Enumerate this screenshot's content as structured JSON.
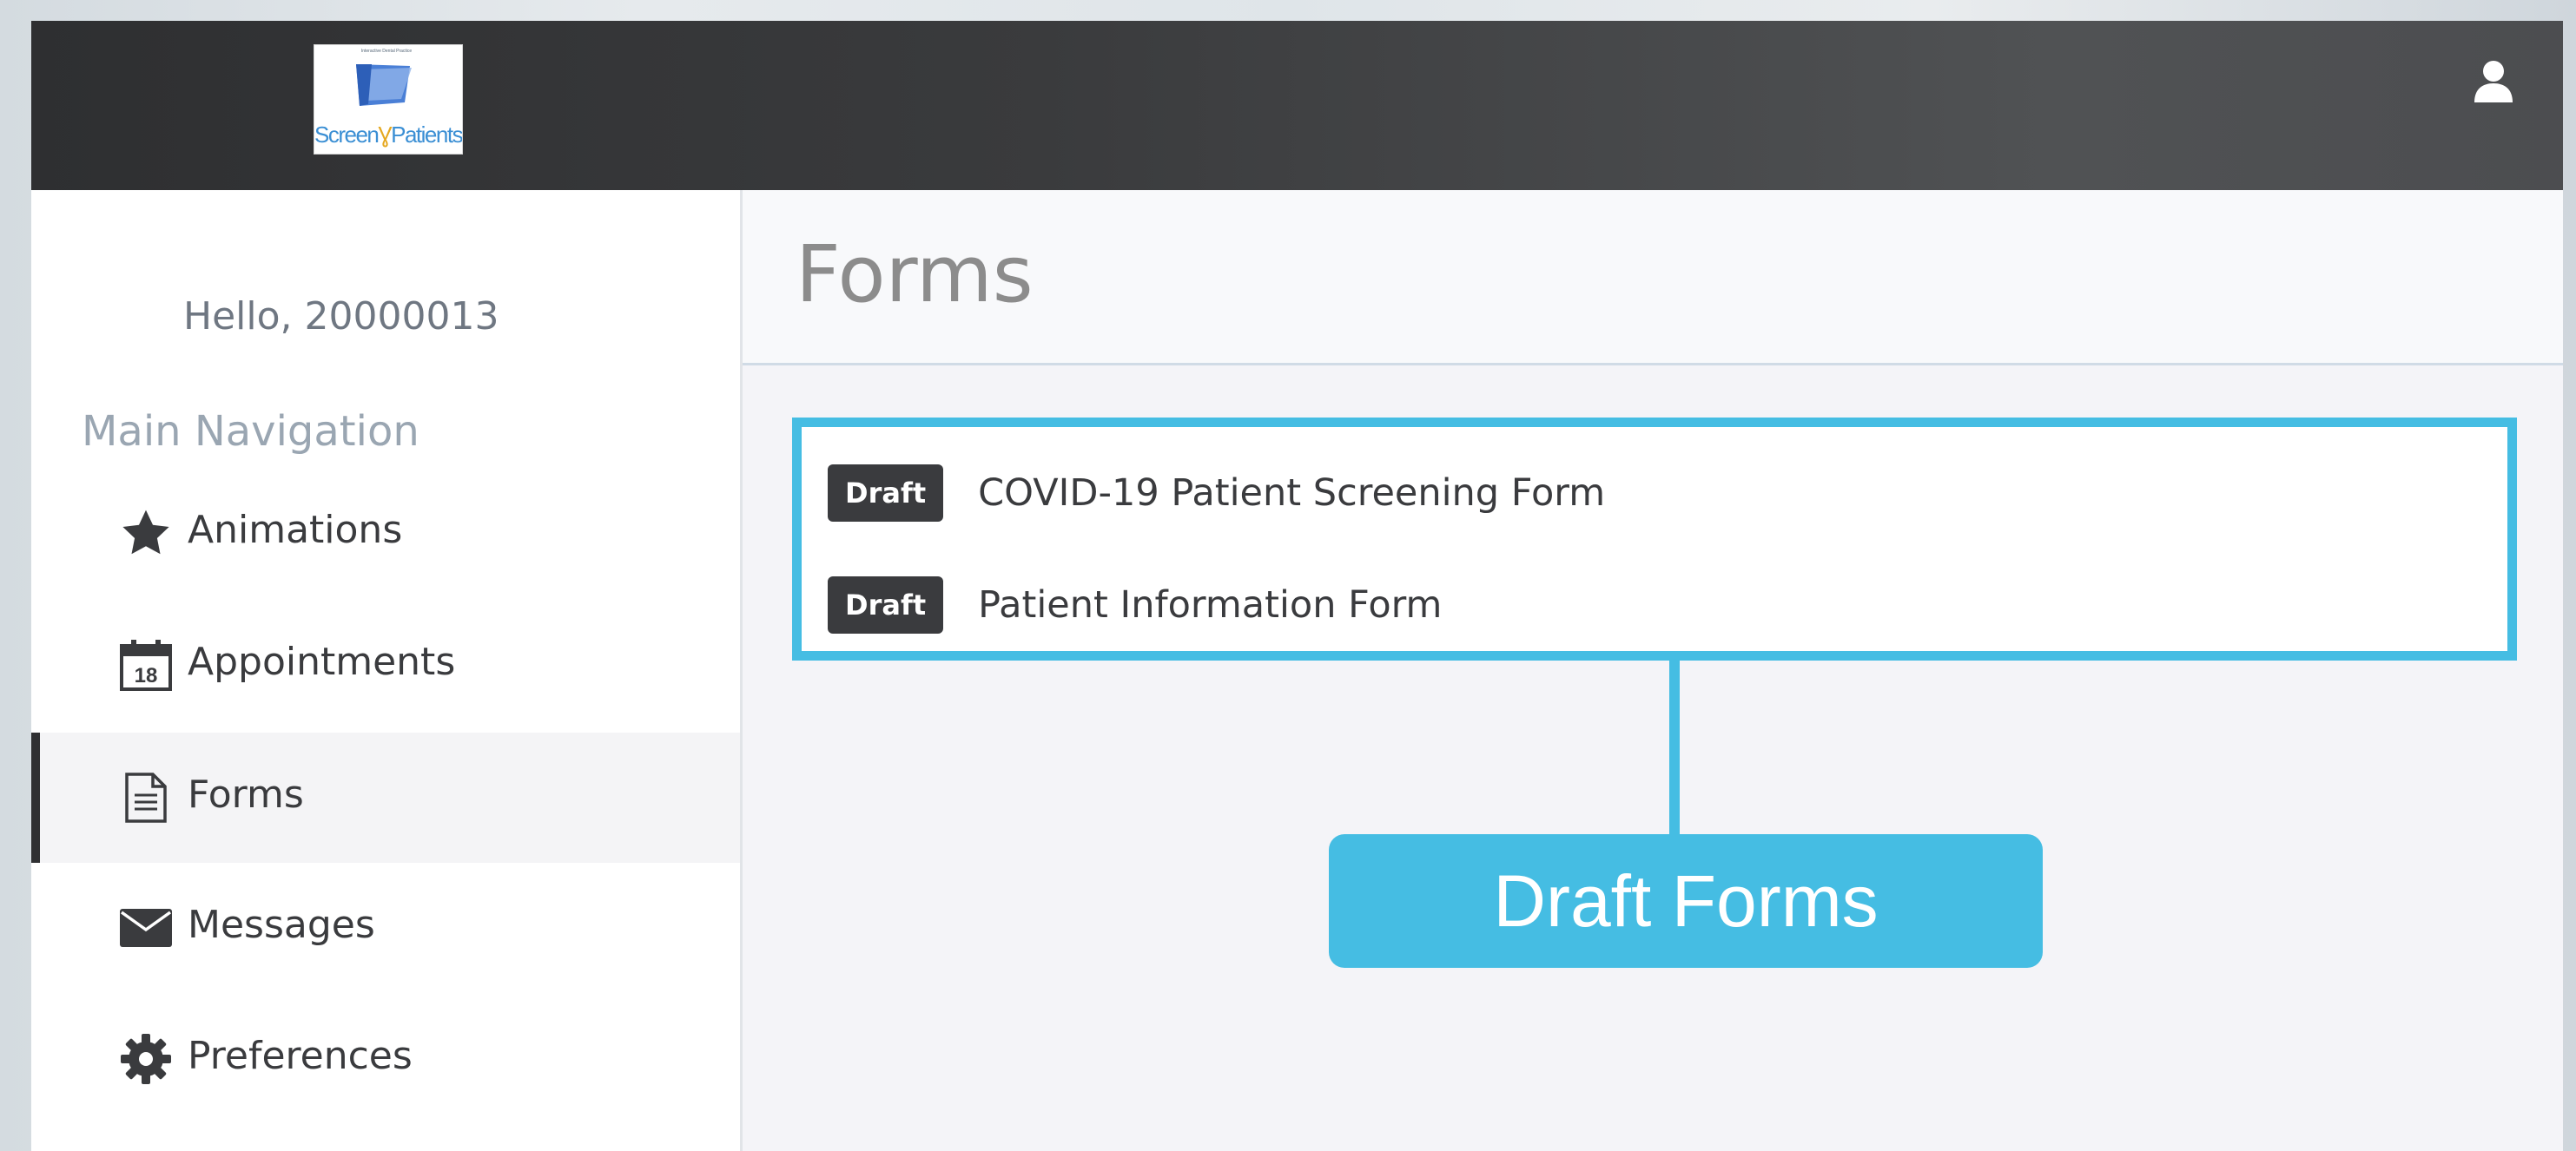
{
  "header": {
    "logo": {
      "tagline": "Interactive Dental Practice",
      "word_left": "Screen",
      "word_right": "Patients"
    },
    "user_icon": "user-icon"
  },
  "sidebar": {
    "greeting": "Hello, 20000013",
    "nav_title": "Main Navigation",
    "items": [
      {
        "label": "Animations",
        "icon": "star-icon"
      },
      {
        "label": "Appointments",
        "icon": "calendar-icon",
        "icon_text": "18"
      },
      {
        "label": "Forms",
        "icon": "document-icon",
        "active": true
      },
      {
        "label": "Messages",
        "icon": "envelope-icon"
      },
      {
        "label": "Preferences",
        "icon": "gear-icon"
      }
    ]
  },
  "main": {
    "title": "Forms",
    "forms": [
      {
        "status": "Draft",
        "name": "COVID-19 Patient Screening Form"
      },
      {
        "status": "Draft",
        "name": "Patient Information Form"
      }
    ],
    "callout": "Draft Forms"
  },
  "colors": {
    "accent": "#45bde3",
    "topbar": "#2e2f31",
    "badge": "#3a3b3e"
  }
}
